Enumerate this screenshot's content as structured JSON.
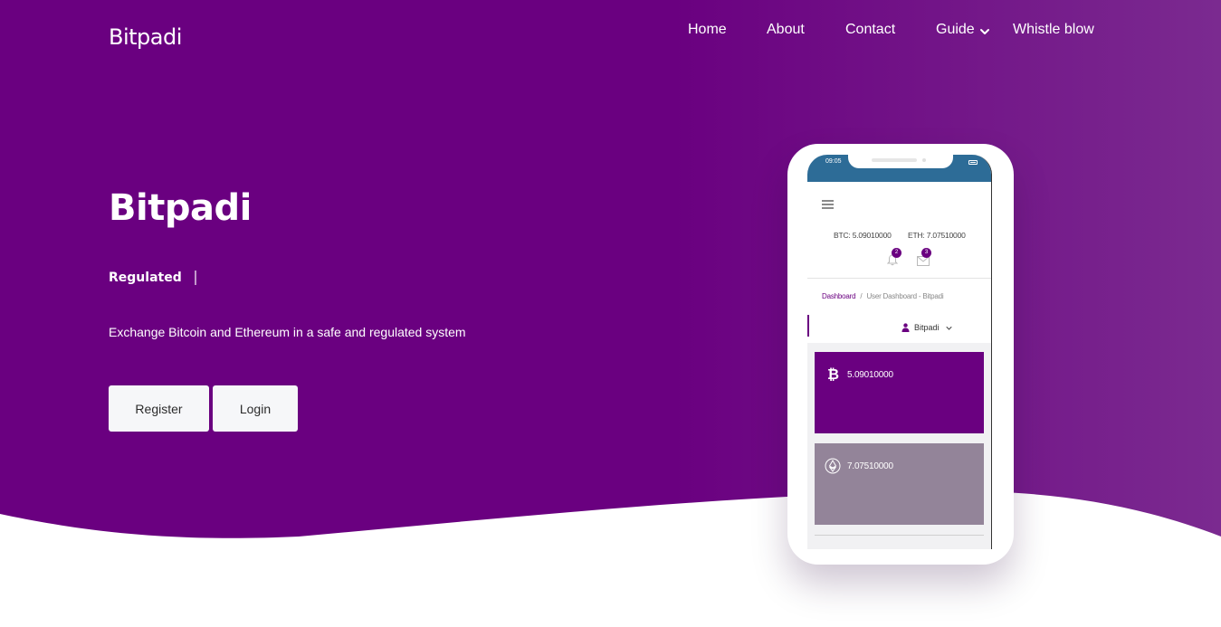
{
  "navbar": {
    "logo": "Bitpadi",
    "links": {
      "home": "Home",
      "about": "About",
      "contact": "Contact",
      "guide": "Guide",
      "whistle": "Whistle blow"
    }
  },
  "hero": {
    "title": "Bitpadi",
    "tagline": "Regulated",
    "description": "Exchange Bitcoin and Ethereum in a safe and regulated system",
    "register_label": "Register",
    "login_label": "Login"
  },
  "phone": {
    "status_time": "09:05",
    "btc_balance": "BTC: 5.09010000",
    "eth_balance": "ETH: 7.07510000",
    "bell_badge": "2",
    "mail_badge": "3",
    "breadcrumb": {
      "link": "Dashboard",
      "separator": "/",
      "current": "User Dashboard - Bitpadi"
    },
    "user_name": "Bitpadi",
    "cards": {
      "btc_value": "5.09010000",
      "eth_value": "7.07510000"
    }
  },
  "colors": {
    "brand_purple": "#6a0080",
    "hero_gradient_end": "#7b2a90",
    "button_bg": "#f6f7f9",
    "eth_card": "#938499",
    "status_bar": "#2d6c97"
  },
  "icons": {
    "guide_chevron": "chevron-down-icon",
    "menu": "hamburger-menu-icon",
    "bell": "bell-icon",
    "mail": "mail-icon",
    "user": "user-icon",
    "btc": "bitcoin-icon",
    "eth": "ethereum-icon"
  }
}
